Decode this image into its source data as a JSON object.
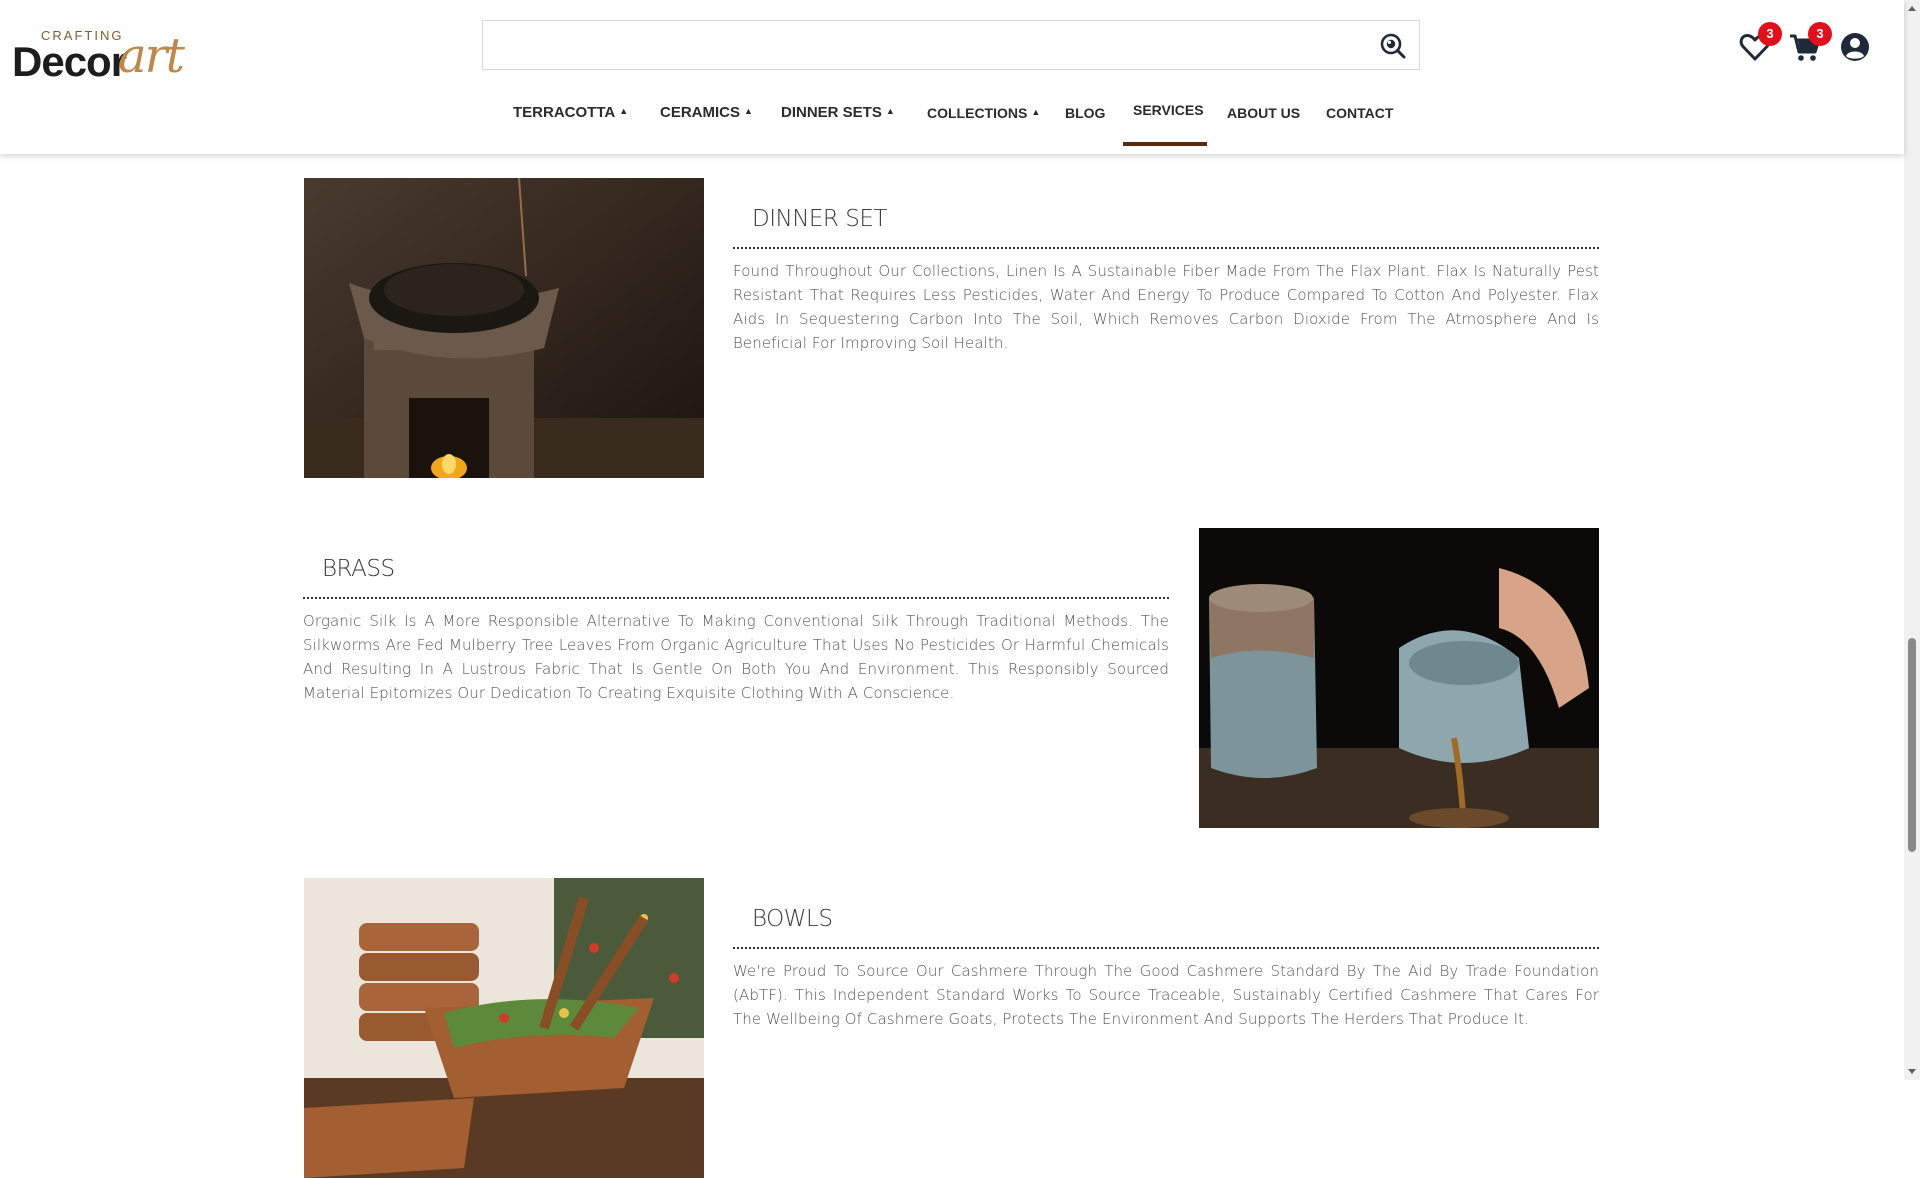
{
  "brand": {
    "top": "CRAFTING",
    "main": "Decor",
    "accent": "art"
  },
  "search": {
    "placeholder": "",
    "value": "",
    "icon": "search-icon"
  },
  "header_icons": {
    "wishlist_count": "3",
    "cart_count": "3",
    "wishlist_icon": "heart-icon",
    "cart_icon": "cart-icon",
    "account_icon": "user-icon",
    "badge_color": "#e3101b"
  },
  "nav": {
    "items": [
      {
        "label": "TERRACOTTA",
        "caret": "▲"
      },
      {
        "label": "CERAMICS",
        "caret": "▲"
      },
      {
        "label": "DINNER SETS",
        "caret": "▲"
      },
      {
        "label": "COLLECTIONS",
        "caret": "▲"
      },
      {
        "label": "BLOG"
      },
      {
        "label": "SERVICES"
      },
      {
        "label": "ABOUT US"
      },
      {
        "label": "CONTACT"
      }
    ],
    "active": "SERVICES",
    "active_color": "#5a2a10"
  },
  "sections": [
    {
      "title": "DINNER SET",
      "description": "Found Throughout Our Collections, Linen Is A Sustainable Fiber Made From The Flax Plant. Flax Is Naturally Pest Resistant That Requires Less Pesticides, Water And Energy To Produce Compared To Cotton And Polyester. Flax Aids In Sequestering Carbon Into The Soil, Which Removes Carbon Dioxide From The Atmosphere And Is Beneficial For Improving Soil Health.",
      "image": "tea-leaves-on-wooden-warmer"
    },
    {
      "title": "BRASS",
      "description": "Organic Silk Is A More Responsible Alternative To Making Conventional Silk Through Traditional Methods. The Silkworms Are Fed Mulberry Tree Leaves From Organic Agriculture That Uses No Pesticides Or Harmful Chemicals And Resulting In A Lustrous Fabric That Is Gentle On Both You And Environment. This Responsibly Sourced Material Epitomizes Our Dedication To Creating Exquisite Clothing With A Conscience.",
      "image": "celadon-teapot-pouring-tea"
    },
    {
      "title": "BOWLS",
      "description": "We're Proud To Source Our Cashmere Through The Good Cashmere Standard By The Aid By Trade Foundation (AbTF). This Independent Standard Works To Source Traceable, Sustainably Certified Cashmere That Cares For The Wellbeing Of Cashmere Goats, Protects The Environment And Supports The Herders That Produce It.",
      "image": "wooden-salad-bowls"
    }
  ]
}
